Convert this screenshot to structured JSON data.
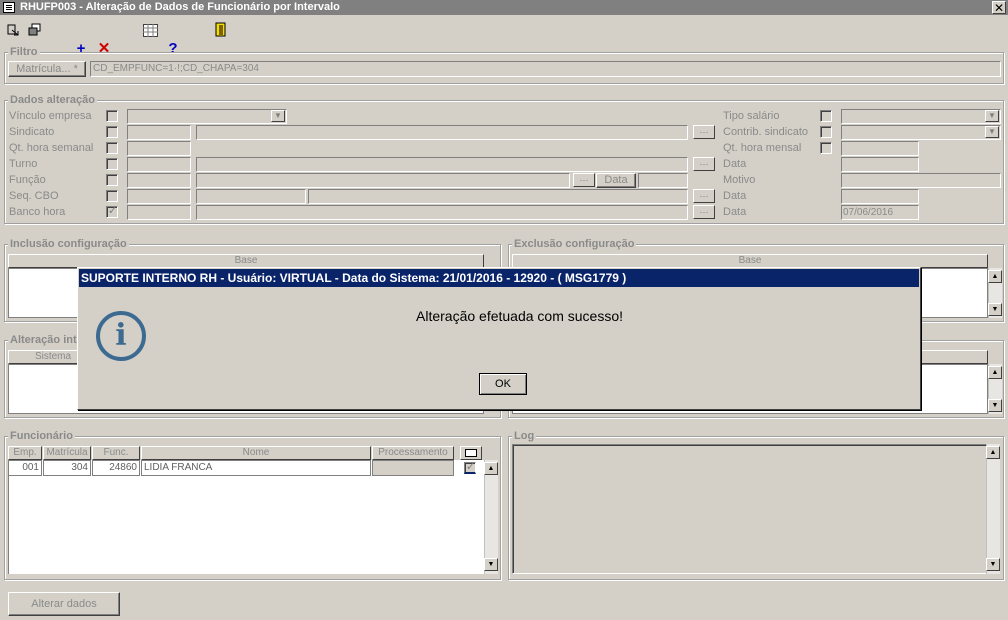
{
  "window": {
    "title": "RHUFP003 - Alteração de Dados de Funcionário por Intervalo",
    "close": "✕"
  },
  "toolbar": {
    "add_icon": "plus-icon",
    "delete_icon": "x-icon",
    "help": "?"
  },
  "filtro": {
    "label": "Filtro",
    "matricula_button": "Matrícula... *",
    "query_value": "CD_EMPFUNC=1·!;CD_CHAPA=304"
  },
  "dados_alteracao": {
    "label": "Dados alteração",
    "left_labels": [
      "Vínculo empresa",
      "Sindicato",
      "Qt. hora semanal",
      "Turno",
      "Função",
      "Seq. CBO",
      "Banco hora"
    ],
    "right_labels": [
      "Tipo salário",
      "Contrib. sindicato",
      "Qt. hora mensal",
      "Data",
      "Motivo",
      "Data",
      "Data"
    ],
    "data_label_inline": "Data",
    "banco_hora_date": "07/06/2016"
  },
  "inclusao": {
    "label": "Inclusão configuração",
    "col_base": "Base"
  },
  "exclusao": {
    "label": "Exclusão configuração",
    "col_base": "Base"
  },
  "alteracao_intervalo": {
    "label": "Alteração int",
    "col_sistema": "Sistema"
  },
  "funcionario": {
    "label": "Funcionário",
    "columns": [
      "Emp.",
      "Matrícula",
      "Func.",
      "Nome",
      "Processamento"
    ],
    "rows": [
      {
        "emp": "001",
        "matricula": "304",
        "func": "24860",
        "nome": "LIDIA FRANCA",
        "processamento": ""
      }
    ]
  },
  "log": {
    "label": "Log"
  },
  "alterar_button": "Alterar dados",
  "dialog": {
    "title": "SUPORTE INTERNO RH - Usuário: VIRTUAL - Data do Sistema: 21/01/2016 - 12920 - ( MSG1779 )",
    "message": "Alteração efetuada com sucesso!",
    "ok": "OK",
    "icon": "info-icon",
    "icon_glyph": "i"
  },
  "colors": {
    "background": "#d4d0c8",
    "dialog_title_bg": "#0a246a",
    "titlebar_bg": "#808080",
    "info_icon": "#3d6a91"
  }
}
